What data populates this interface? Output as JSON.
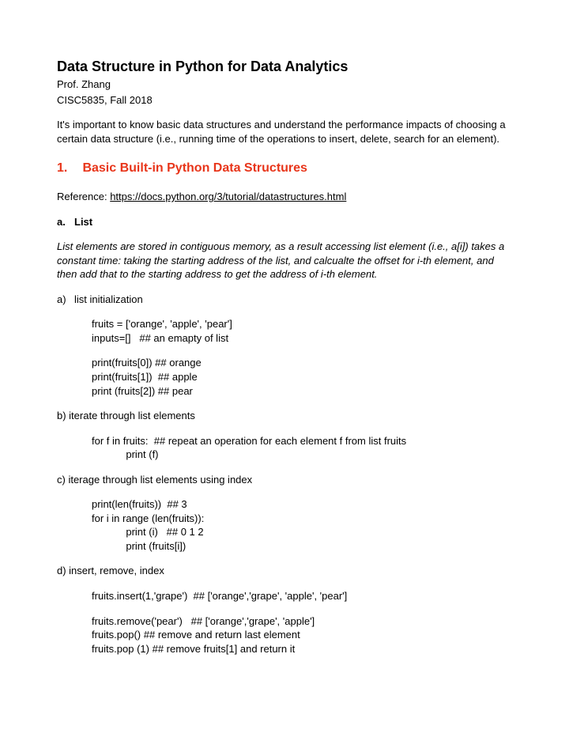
{
  "title": "Data Structure in Python for Data Analytics",
  "author": "Prof. Zhang",
  "course": "CISC5835, Fall 2018",
  "intro": "It's important to know basic data structures and understand the performance impacts of choosing a certain data structure (i.e., running time of the operations to insert, delete, search for an element).",
  "section": {
    "number": "1.",
    "title": "Basic Built-in Python Data Structures"
  },
  "reference": {
    "label": "Reference: ",
    "url": "https://docs.python.org/3/tutorial/datastructures.html"
  },
  "subA": {
    "letter": "a.",
    "label": "List"
  },
  "italicBlock": "List elements are stored in contiguous memory, as a result accessing list element (i.e., a[i]) takes a constant time: taking the starting address of the list, and calcualte the offset for i-th element, and then add that to the starting address to get the address of i-th element.",
  "itemA": {
    "letter": "a)",
    "label": "list initialization",
    "code1": "fruits = ['orange', 'apple', 'pear']\ninputs=[]   ## an emapty of list",
    "code2": "print(fruits[0]) ## orange\nprint(fruits[1])  ## apple\nprint (fruits[2]) ## pear"
  },
  "itemB": {
    "label": "b) iterate through list elements",
    "code": "for f in fruits:  ## repeat an operation for each element f from list fruits\n            print (f)"
  },
  "itemC": {
    "label": "c) iterage through list elements using index",
    "code": "print(len(fruits))  ## 3\nfor i in range (len(fruits)):\n            print (i)   ## 0 1 2\n            print (fruits[i])"
  },
  "itemD": {
    "label": "d) insert, remove, index",
    "code1": "fruits.insert(1,'grape')  ## ['orange','grape', 'apple', 'pear']",
    "code2": "fruits.remove('pear')   ## ['orange','grape', 'apple']\nfruits.pop() ## remove and return last element\nfruits.pop (1) ## remove fruits[1] and return it"
  }
}
